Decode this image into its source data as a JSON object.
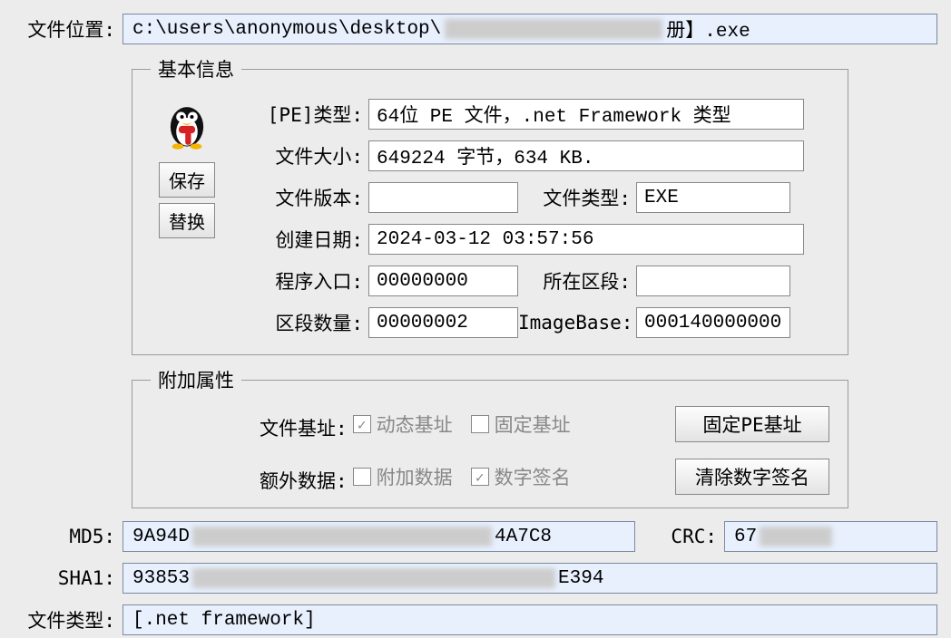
{
  "file_location": {
    "label": "文件位置:",
    "prefix": "c:\\users\\anonymous\\desktop\\",
    "redacted": "██████ ██████",
    "suffix": "册】.exe"
  },
  "basic_info": {
    "legend": "基本信息",
    "save_btn": "保存",
    "replace_btn": "替换",
    "pe_type_label": "[PE]类型:",
    "pe_type_value": "64位 PE 文件，.net Framework 类型",
    "file_size_label": "文件大小:",
    "file_size_value": "649224 字节，634 KB.",
    "file_version_label": "文件版本:",
    "file_version_value": "",
    "file_type_label": "文件类型:",
    "file_type_value": "EXE",
    "create_date_label": "创建日期:",
    "create_date_value": "2024-03-12 03:57:56",
    "entry_label": "程序入口:",
    "entry_value": "00000000",
    "section_label": "所在区段:",
    "section_value": "",
    "section_count_label": "区段数量:",
    "section_count_value": "00000002",
    "imagebase_label": "ImageBase:",
    "imagebase_value": "000140000000"
  },
  "extra_attr": {
    "legend": "附加属性",
    "file_base_label": "文件基址:",
    "dynamic_base": "动态基址",
    "fixed_base": "固定基址",
    "fix_pe_btn": "固定PE基址",
    "extra_data_label": "额外数据:",
    "extra_data": "附加数据",
    "digital_sig": "数字签名",
    "clear_sig_btn": "清除数字签名",
    "dynamic_checked": true,
    "fixed_checked": false,
    "extradata_checked": false,
    "digsig_checked": true
  },
  "hashes": {
    "md5_label": "MD5:",
    "md5_prefix": "9A94D",
    "md5_suffix": "4A7C8",
    "crc_label": "CRC:",
    "crc_prefix": "67",
    "sha1_label": "SHA1:",
    "sha1_prefix": "93853",
    "sha1_suffix": "E394",
    "filetype_label": "文件类型:",
    "filetype_value": "[.net framework]"
  }
}
